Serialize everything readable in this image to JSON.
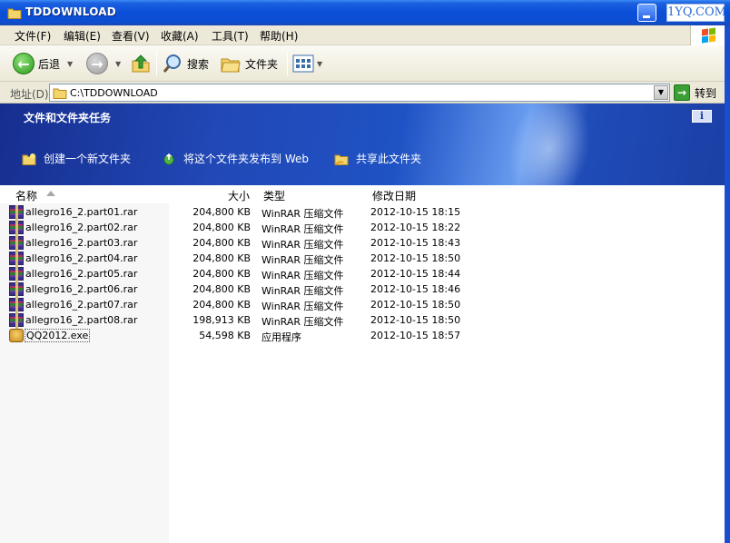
{
  "window": {
    "title": "TDDOWNLOAD",
    "brand": "1YQ.COM"
  },
  "menu": [
    {
      "label": "文件(F)"
    },
    {
      "label": "编辑(E)"
    },
    {
      "label": "查看(V)"
    },
    {
      "label": "收藏(A)"
    },
    {
      "label": "工具(T)"
    },
    {
      "label": "帮助(H)"
    }
  ],
  "toolbar": {
    "back": "后退",
    "search": "搜索",
    "folders": "文件夹"
  },
  "address": {
    "label": "地址(D)",
    "path": "C:\\TDDOWNLOAD",
    "go": "转到"
  },
  "tasks": {
    "heading": "文件和文件夹任务",
    "info_icon": "i",
    "items": [
      {
        "label": "创建一个新文件夹",
        "icon": "new-folder-icon"
      },
      {
        "label": "将这个文件夹发布到 Web",
        "icon": "publish-web-icon"
      },
      {
        "label": "共享此文件夹",
        "icon": "share-folder-icon"
      }
    ]
  },
  "columns": {
    "name": "名称",
    "size": "大小",
    "type": "类型",
    "modified": "修改日期"
  },
  "files": [
    {
      "name": "allegro16_2.part01.rar",
      "size": "204,800 KB",
      "type": "WinRAR 压缩文件",
      "modified": "2012-10-15 18:15",
      "icon": "rar"
    },
    {
      "name": "allegro16_2.part02.rar",
      "size": "204,800 KB",
      "type": "WinRAR 压缩文件",
      "modified": "2012-10-15 18:22",
      "icon": "rar"
    },
    {
      "name": "allegro16_2.part03.rar",
      "size": "204,800 KB",
      "type": "WinRAR 压缩文件",
      "modified": "2012-10-15 18:43",
      "icon": "rar"
    },
    {
      "name": "allegro16_2.part04.rar",
      "size": "204,800 KB",
      "type": "WinRAR 压缩文件",
      "modified": "2012-10-15 18:50",
      "icon": "rar"
    },
    {
      "name": "allegro16_2.part05.rar",
      "size": "204,800 KB",
      "type": "WinRAR 压缩文件",
      "modified": "2012-10-15 18:44",
      "icon": "rar"
    },
    {
      "name": "allegro16_2.part06.rar",
      "size": "204,800 KB",
      "type": "WinRAR 压缩文件",
      "modified": "2012-10-15 18:46",
      "icon": "rar"
    },
    {
      "name": "allegro16_2.part07.rar",
      "size": "204,800 KB",
      "type": "WinRAR 压缩文件",
      "modified": "2012-10-15 18:50",
      "icon": "rar"
    },
    {
      "name": "allegro16_2.part08.rar",
      "size": "198,913 KB",
      "type": "WinRAR 压缩文件",
      "modified": "2012-10-15 18:50",
      "icon": "rar"
    },
    {
      "name": "QQ2012.exe",
      "size": "54,598 KB",
      "type": "应用程序",
      "modified": "2012-10-15 18:57",
      "icon": "exe",
      "selected": true
    }
  ]
}
